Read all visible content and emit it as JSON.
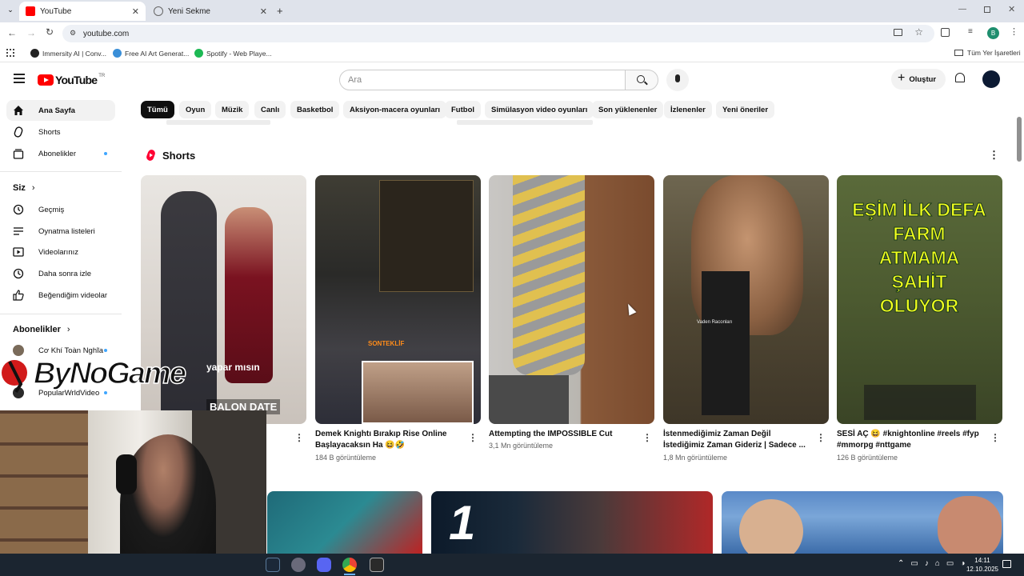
{
  "browser": {
    "tabs": [
      {
        "label": "YouTube",
        "active": true
      },
      {
        "label": "Yeni Sekme",
        "active": false
      }
    ],
    "url": "youtube.com",
    "bookmarks": [
      "Immersity AI | Conv...",
      "Free AI Art Generat...",
      "Spotify - Web Playe..."
    ],
    "all_bookmarks_label": "Tüm Yer İşaretleri",
    "profile_initial": "B"
  },
  "youtube": {
    "logo_text": "YouTube",
    "logo_region": "TR",
    "search_placeholder": "Ara",
    "create_label": "Oluştur",
    "chips": [
      "Tümü",
      "Oyun",
      "Müzik",
      "Canlı",
      "Basketbol",
      "Aksiyon-macera oyunları",
      "Futbol",
      "Simülasyon video oyunları",
      "Son yüklenenler",
      "İzlenenler",
      "Yeni öneriler"
    ],
    "sidebar": {
      "main": [
        {
          "label": "Ana Sayfa",
          "icon": "home-icon",
          "active": true
        },
        {
          "label": "Shorts",
          "icon": "shorts-icon"
        },
        {
          "label": "Abonelikler",
          "icon": "subscriptions-icon",
          "dot": true
        }
      ],
      "you_header": "Siz",
      "you": [
        {
          "label": "Geçmiş",
          "icon": "history-icon"
        },
        {
          "label": "Oynatma listeleri",
          "icon": "playlists-icon"
        },
        {
          "label": "Videolarınız",
          "icon": "your-videos-icon"
        },
        {
          "label": "Daha sonra izle",
          "icon": "watch-later-icon"
        },
        {
          "label": "Beğendiğim videolar",
          "icon": "liked-icon"
        }
      ],
      "subs_header": "Abonelikler",
      "subs": [
        {
          "label": "Cơ Khí Toàn Nghĩa",
          "dot": true
        },
        {
          "label": "PopularWrldVideo",
          "dot": true
        }
      ]
    },
    "shorts_header": "Shorts",
    "shorts": [
      {
        "title": "",
        "views": "",
        "overlay": "yapar mısın",
        "overlay2": "BALON DATE"
      },
      {
        "title": "Demek Knightı Bırakıp Rise Online Başlayacaksın Ha 😆🤣",
        "views": "184 B görüntüleme",
        "overlay": "SONTEKLİF"
      },
      {
        "title": "Attempting the IMPOSSIBLE Cut",
        "views": "3,1 Mn görüntüleme"
      },
      {
        "title": "İstenmediğimiz Zaman Değil İstediğimiz Zaman Gideriz | Sadece ...",
        "views": "1,8 Mn görüntüleme",
        "overlay": "Vaden Raconları"
      },
      {
        "title": "SESİ AÇ 😆 #knightonline #reels #fyp #mmorpg #nttgame",
        "views": "126 B görüntüleme",
        "overlay": "EŞİM İLK DEFA FARM ATMAMA ŞAHİT OLUYOR"
      }
    ]
  },
  "stream_overlay": {
    "brand": "ByNoGame"
  },
  "taskbar": {
    "time": "14:11",
    "date": "12.10.2025"
  }
}
